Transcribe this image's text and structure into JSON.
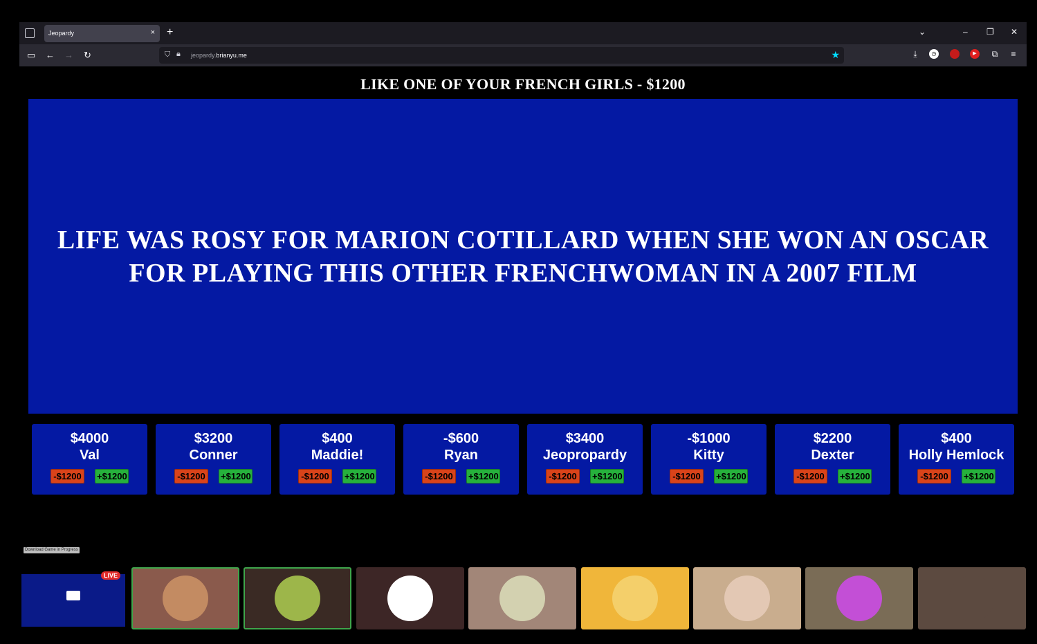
{
  "browser": {
    "tab_title": "Jeopardy",
    "tab_close": "×",
    "new_tab": "+",
    "url_prefix": "jeopardy.",
    "url_domain": "brianyu.me"
  },
  "game": {
    "category_header": "LIKE ONE OF YOUR FRENCH GIRLS - $1200",
    "clue": "LIFE WAS ROSY FOR MARION COTILLARD WHEN SHE WON AN OSCAR FOR PLAYING THIS OTHER FRENCHWOMAN IN A 2007 FILM",
    "minus_label": "-$1200",
    "plus_label": "+$1200",
    "players": [
      {
        "score": "$4000",
        "name": "Val"
      },
      {
        "score": "$3200",
        "name": "Conner"
      },
      {
        "score": "$400",
        "name": "Maddie!"
      },
      {
        "score": "-$600",
        "name": "Ryan"
      },
      {
        "score": "$3400",
        "name": "Jeopropardy"
      },
      {
        "score": "-$1000",
        "name": "Kitty"
      },
      {
        "score": "$2200",
        "name": "Dexter"
      },
      {
        "score": "$400",
        "name": "Holly Hemlock"
      }
    ]
  },
  "download_label": "Download Game in Progress",
  "stream": {
    "live_badge": "LIVE",
    "tiles": [
      {
        "bg": "#8a5a4c",
        "avatar": "#c38b62",
        "speaking": true
      },
      {
        "bg": "#3a2a24",
        "avatar": "#9db64a",
        "speaking": true
      },
      {
        "bg": "#3d2626",
        "avatar": "#ffffff",
        "speaking": false
      },
      {
        "bg": "#a28678",
        "avatar": "#d3d1b0",
        "speaking": false
      },
      {
        "bg": "#f0b63a",
        "avatar": "#f4cf6a",
        "speaking": false
      },
      {
        "bg": "#c9ad8e",
        "avatar": "#e3c8b4",
        "speaking": false
      },
      {
        "bg": "#7a6c56",
        "avatar": "#c34fd6",
        "speaking": false
      },
      {
        "bg": "#5c4a40",
        "avatar": "#5c4a40",
        "speaking": false
      }
    ]
  },
  "colors": {
    "board_blue": "#0419a3",
    "minus_red": "#d9431a",
    "plus_green": "#26b13c",
    "accent_star": "#00ddff"
  }
}
